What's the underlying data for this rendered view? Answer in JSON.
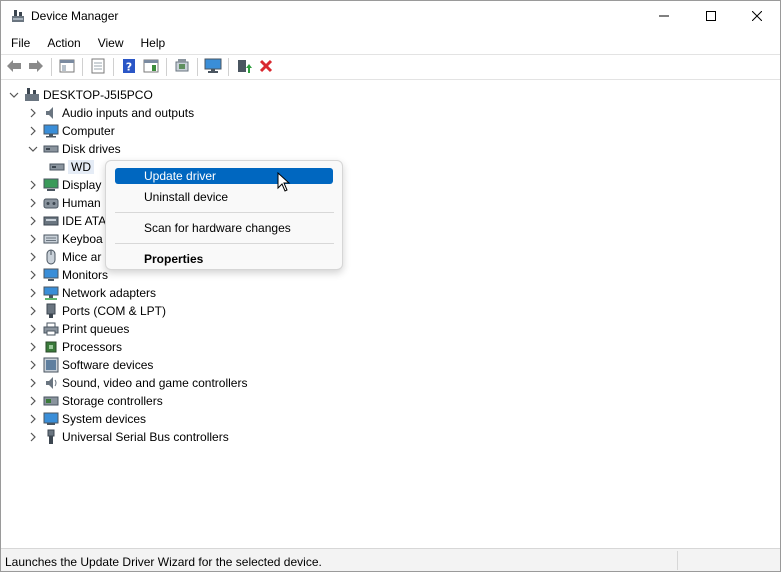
{
  "window": {
    "title": "Device Manager",
    "icon": "device-manager-icon"
  },
  "menubar": {
    "items": [
      "File",
      "Action",
      "View",
      "Help"
    ]
  },
  "toolbar": {
    "buttons": [
      "back-arrow-icon",
      "forward-arrow-icon",
      "show-hide-console-tree-icon",
      "properties-icon",
      "help-icon",
      "action-pane-icon",
      "scan-hardware-icon",
      "monitor-icon",
      "add-driver-icon",
      "uninstall-x-icon"
    ],
    "uninstall_color": "#d9282f"
  },
  "tree": {
    "root": "DESKTOP-J5I5PCO",
    "items": [
      {
        "label": "Audio inputs and outputs",
        "expanded": false
      },
      {
        "label": "Computer",
        "expanded": false
      },
      {
        "label": "Disk drives",
        "expanded": true
      },
      {
        "label": "WD",
        "child": true,
        "selected": true
      },
      {
        "label": "Display",
        "expanded": false
      },
      {
        "label": "Human",
        "expanded": false
      },
      {
        "label": "IDE ATA",
        "expanded": false
      },
      {
        "label": "Keyboa",
        "expanded": false
      },
      {
        "label": "Mice ar",
        "expanded": false
      },
      {
        "label": "Monitors",
        "expanded": false
      },
      {
        "label": "Network adapters",
        "expanded": false
      },
      {
        "label": "Ports (COM & LPT)",
        "expanded": false
      },
      {
        "label": "Print queues",
        "expanded": false
      },
      {
        "label": "Processors",
        "expanded": false
      },
      {
        "label": "Software devices",
        "expanded": false
      },
      {
        "label": "Sound, video and game controllers",
        "expanded": false
      },
      {
        "label": "Storage controllers",
        "expanded": false
      },
      {
        "label": "System devices",
        "expanded": false
      },
      {
        "label": "Universal Serial Bus controllers",
        "expanded": false
      }
    ]
  },
  "context_menu": {
    "items": [
      {
        "label": "Update driver",
        "highlighted": true
      },
      {
        "label": "Uninstall device"
      },
      {
        "label": "Scan for hardware changes"
      },
      {
        "label": "Properties",
        "bold": true
      }
    ],
    "highlight_color": "#0067c0"
  },
  "statusbar": {
    "text": "Launches the Update Driver Wizard for the selected device."
  }
}
